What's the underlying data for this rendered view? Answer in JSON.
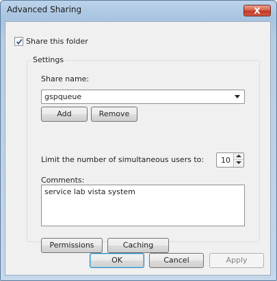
{
  "window": {
    "title": "Advanced Sharing",
    "close_label": "X"
  },
  "share_folder": {
    "label": "Share this folder",
    "checked": true
  },
  "settings": {
    "group_label": "Settings",
    "share_name_label": "Share name:",
    "share_name_value": "gspqueue",
    "add_label": "Add",
    "remove_label": "Remove",
    "limit_label": "Limit the number of simultaneous users to:",
    "limit_value": "10",
    "comments_label": "Comments:",
    "comments_value": "service lab vista system",
    "permissions_label": "Permissions",
    "caching_label": "Caching"
  },
  "footer": {
    "ok_label": "OK",
    "cancel_label": "Cancel",
    "apply_label": "Apply"
  },
  "colors": {
    "title_bar": "#a8c4e0",
    "close_button": "#c0392b",
    "dialog_body": "#f0f0f0",
    "default_button_border": "#3c7fb1"
  }
}
